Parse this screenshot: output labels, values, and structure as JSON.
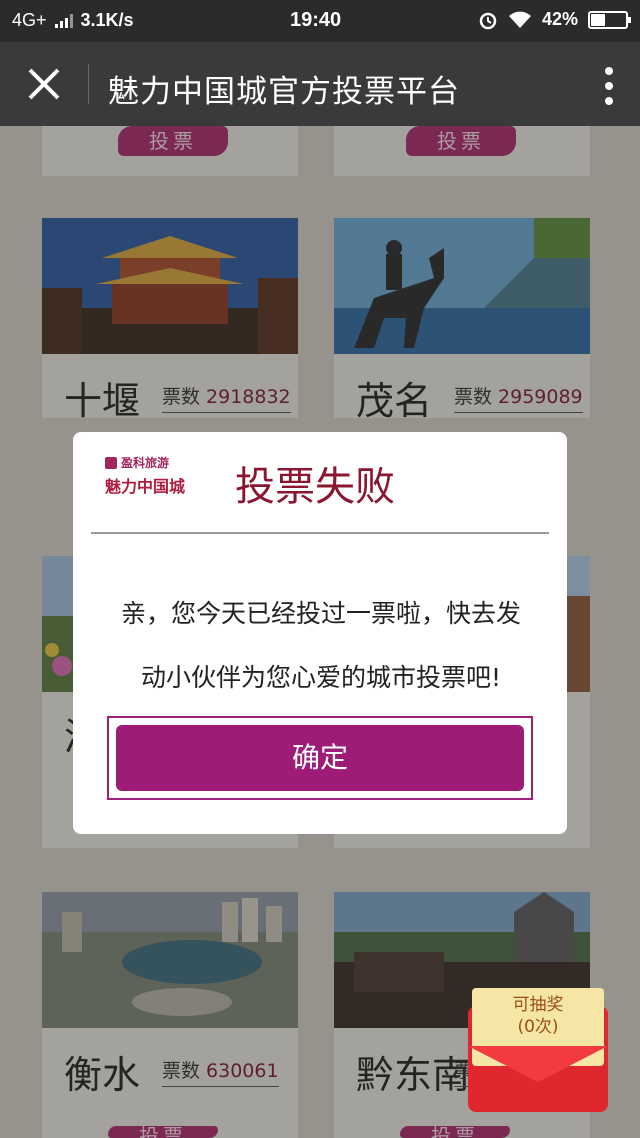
{
  "status_bar": {
    "network": "4G+",
    "speed": "3.1K/s",
    "time": "19:40",
    "battery": "42%",
    "battery_level": 0.42
  },
  "header": {
    "title": "魅力中国城官方投票平台"
  },
  "vote_button_label": "投票",
  "votes_label": "票数",
  "cities": [
    {
      "name": "十堰",
      "votes": "2918832"
    },
    {
      "name": "茂名",
      "votes": "2959089"
    },
    {
      "name": "衡水",
      "votes": "630061"
    },
    {
      "name": "黔东南",
      "votes": ""
    }
  ],
  "partial_city_glyph": "济",
  "modal": {
    "logo_top": "盈科旅游",
    "logo_main": "魅力中国城",
    "title": "投票失败",
    "line1": "亲，您今天已经投过一票啦，快去发",
    "line2": "动小伙伴为您心爱的城市投票吧!",
    "confirm_label": "确定"
  },
  "envelope": {
    "line1": "可抽奖",
    "line2": "(0次)"
  }
}
